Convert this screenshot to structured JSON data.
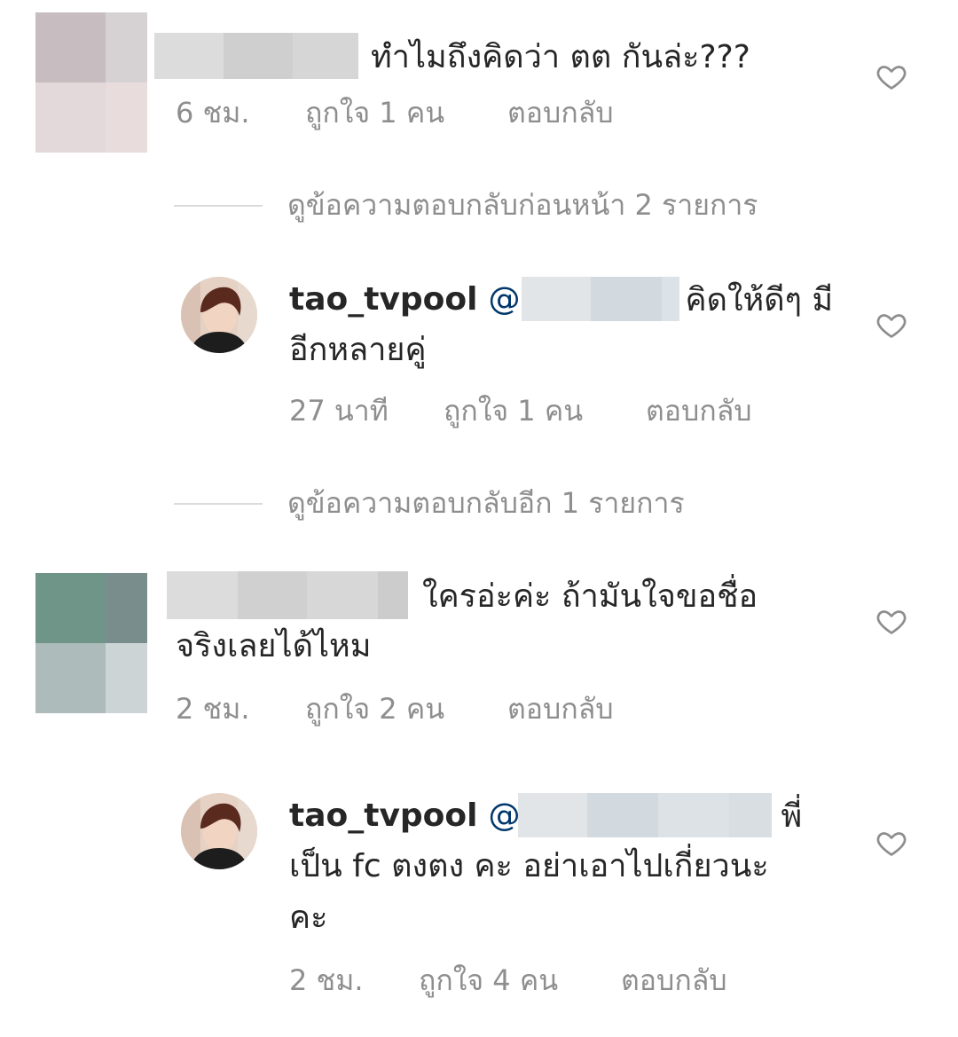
{
  "comments": [
    {
      "text_after_redaction": "ทำไมถึงคิดว่า ตต กันล่ะ???",
      "time": "6 ชม.",
      "likes": "ถูกใจ 1 คน",
      "reply": "ตอบกลับ",
      "view_more": "ดูข้อความตอบกลับก่อนหน้า 2 รายการ",
      "reply_item": {
        "username": "tao_tvpool",
        "mention_prefix": "@",
        "text_line1": "คิดให้ดีๆ มี",
        "text_line2": "อีกหลายคู่",
        "time": "27 นาที",
        "likes": "ถูกใจ 1 คน",
        "reply": "ตอบกลับ"
      },
      "view_more_after": "ดูข้อความตอบกลับอีก 1 รายการ"
    },
    {
      "text_line1_after_redaction": "ใครอ่ะค่ะ ถ้ามันใจขอชื่อ",
      "text_line2": "จริงเลยได้ไหม",
      "time": "2 ชม.",
      "likes": "ถูกใจ 2 คน",
      "reply": "ตอบกลับ",
      "reply_item": {
        "username": "tao_tvpool",
        "mention_prefix": "@",
        "text_line1_after_redaction": "พี่",
        "text_line2": "เป็น fc ตงตง คะ อย่าเอาไปเกี่ยวนะ",
        "text_line3": "คะ",
        "time": "2 ชม.",
        "likes": "ถูกใจ 4 คน",
        "reply": "ตอบกลับ"
      }
    }
  ],
  "icons": {
    "heart": "heart-outline-icon"
  },
  "colors": {
    "text": "#262626",
    "meta": "#8e8e8e",
    "mention": "#00376b",
    "divider": "#dbdbdb"
  }
}
